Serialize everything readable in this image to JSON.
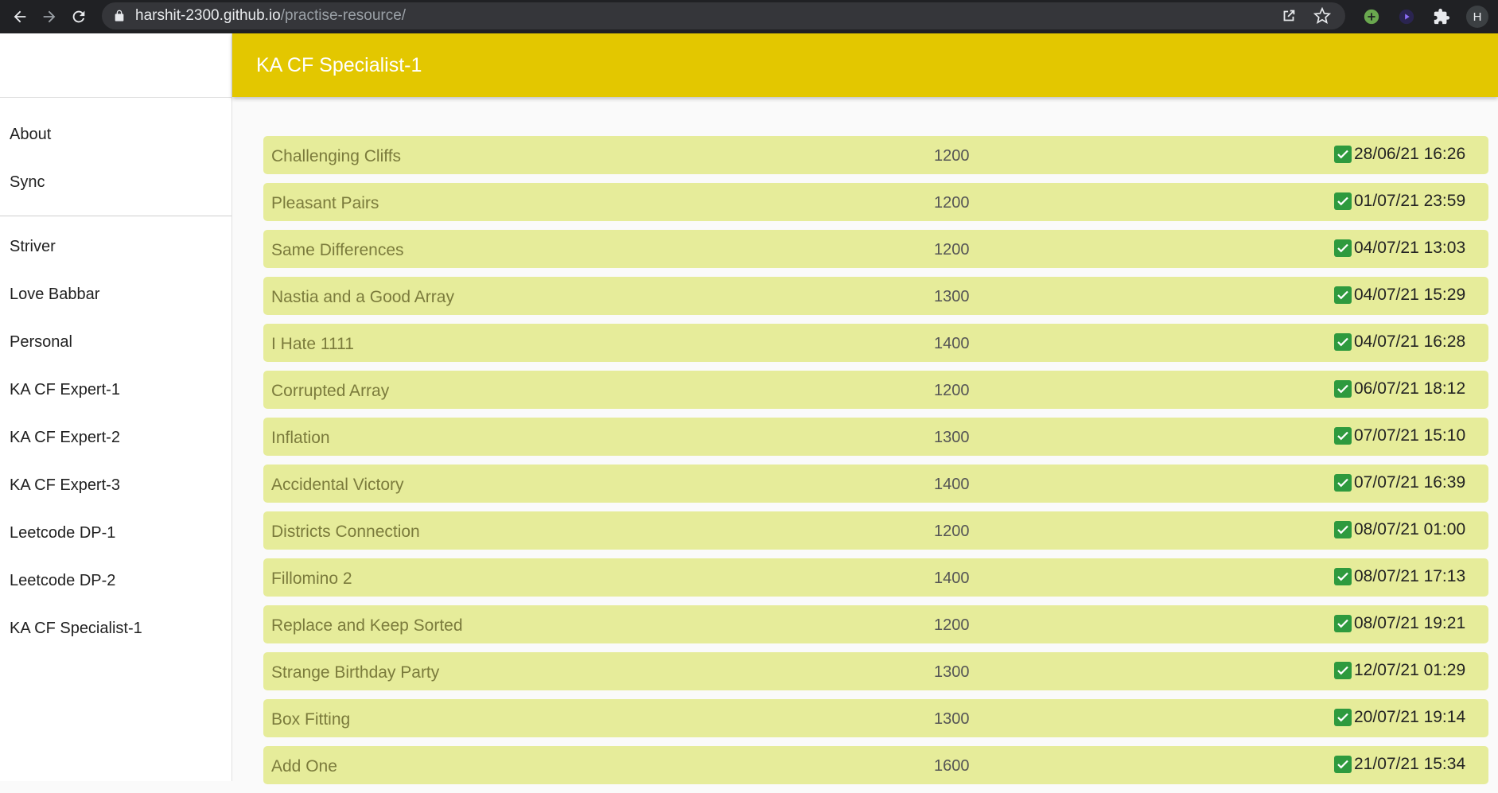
{
  "browser": {
    "url_host": "harshit-2300.github.io",
    "url_path": "/practise-resource/",
    "profile_initial": "H",
    "icons": [
      "back-arrow-icon",
      "forward-arrow-icon",
      "reload-icon",
      "lock-icon",
      "share-icon",
      "star-icon",
      "extension-green-icon",
      "extension-play-icon",
      "puzzle-icon"
    ]
  },
  "sidebar": {
    "top_items": [
      {
        "label": "About"
      },
      {
        "label": "Sync"
      }
    ],
    "items": [
      {
        "label": "Striver"
      },
      {
        "label": "Love Babbar"
      },
      {
        "label": "Personal"
      },
      {
        "label": "KA CF Expert-1"
      },
      {
        "label": "KA CF Expert-2"
      },
      {
        "label": "KA CF Expert-3"
      },
      {
        "label": "Leetcode DP-1"
      },
      {
        "label": "Leetcode DP-2"
      },
      {
        "label": "KA CF Specialist-1"
      }
    ]
  },
  "header": {
    "title": "KA CF Specialist-1"
  },
  "problems": [
    {
      "name": "Challenging Cliffs",
      "rating": "1200",
      "date": "28/06/21 16:26",
      "done": true
    },
    {
      "name": "Pleasant Pairs",
      "rating": "1200",
      "date": "01/07/21 23:59",
      "done": true
    },
    {
      "name": "Same Differences",
      "rating": "1200",
      "date": "04/07/21 13:03",
      "done": true
    },
    {
      "name": "Nastia and a Good Array",
      "rating": "1300",
      "date": "04/07/21 15:29",
      "done": true
    },
    {
      "name": "I Hate 1111",
      "rating": "1400",
      "date": "04/07/21 16:28",
      "done": true
    },
    {
      "name": "Corrupted Array",
      "rating": "1200",
      "date": "06/07/21 18:12",
      "done": true
    },
    {
      "name": "Inflation",
      "rating": "1300",
      "date": "07/07/21 15:10",
      "done": true
    },
    {
      "name": "Accidental Victory",
      "rating": "1400",
      "date": "07/07/21 16:39",
      "done": true
    },
    {
      "name": "Districts Connection",
      "rating": "1200",
      "date": "08/07/21 01:00",
      "done": true
    },
    {
      "name": "Fillomino 2",
      "rating": "1400",
      "date": "08/07/21 17:13",
      "done": true
    },
    {
      "name": "Replace and Keep Sorted",
      "rating": "1200",
      "date": "08/07/21 19:21",
      "done": true
    },
    {
      "name": "Strange Birthday Party",
      "rating": "1300",
      "date": "12/07/21 01:29",
      "done": true
    },
    {
      "name": "Box Fitting",
      "rating": "1300",
      "date": "20/07/21 19:14",
      "done": true
    },
    {
      "name": "Add One",
      "rating": "1600",
      "date": "21/07/21 15:34",
      "done": true
    }
  ],
  "colors": {
    "header": "#e3c700",
    "row": "#e6ec9a",
    "check": "#2e9a3e"
  }
}
